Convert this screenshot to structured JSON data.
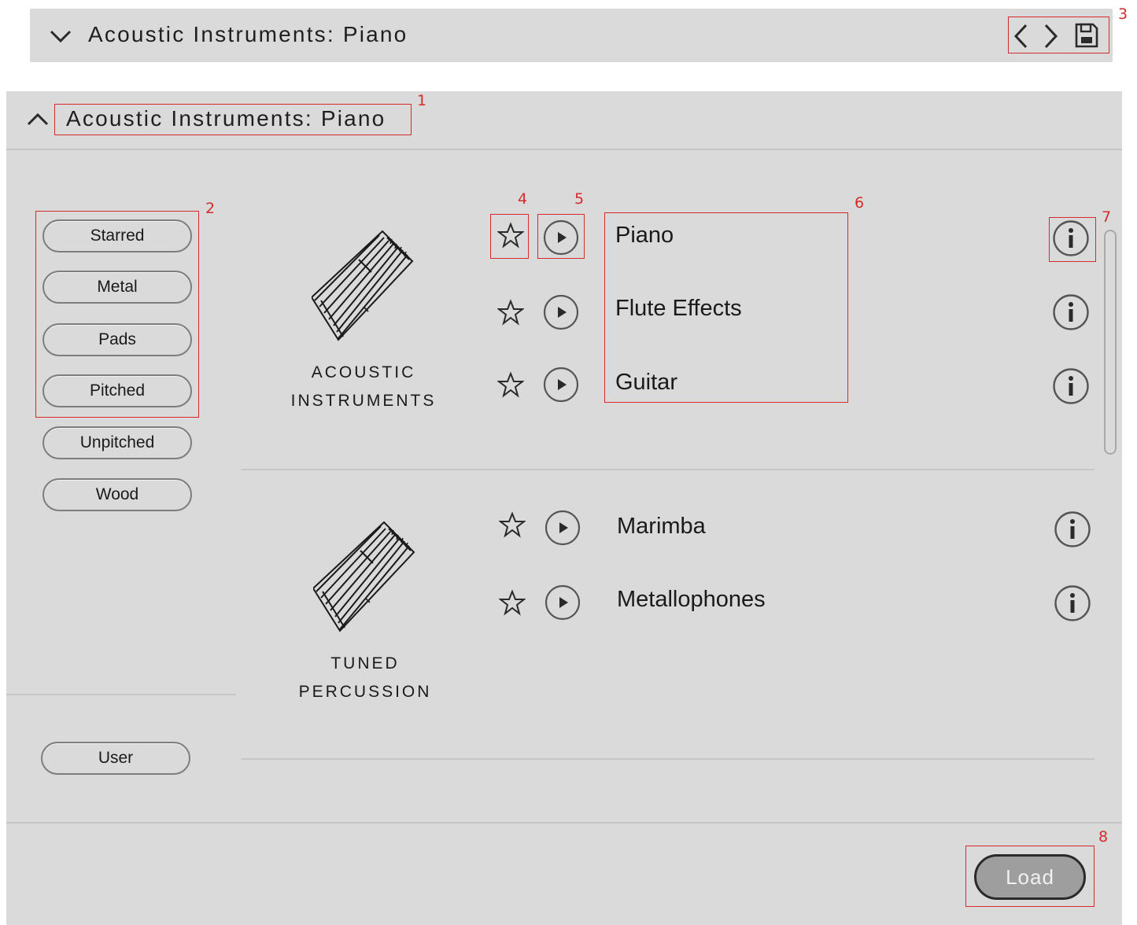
{
  "header": {
    "title": "Acoustic Instruments: Piano",
    "icons": {
      "collapse": "chevron-down-icon",
      "prev": "chevron-left-icon",
      "next": "chevron-right-icon",
      "save": "save-icon"
    }
  },
  "browser": {
    "title": "Acoustic Instruments: Piano",
    "tags": [
      "Starred",
      "Metal",
      "Pads",
      "Pitched",
      "Unpitched",
      "Wood"
    ],
    "user_label": "User",
    "categories": [
      {
        "label_line1": "ACOUSTIC",
        "label_line2": "INSTRUMENTS",
        "sounds": [
          "Piano",
          "Flute Effects",
          "Guitar"
        ]
      },
      {
        "label_line1": "TUNED",
        "label_line2": "PERCUSSION",
        "sounds": [
          "Marimba",
          "Metallophones"
        ]
      }
    ],
    "load_label": "Load"
  },
  "callouts": [
    "1",
    "2",
    "3",
    "4",
    "5",
    "6",
    "7",
    "8"
  ],
  "colors": {
    "panel": "#dadada",
    "callout": "#d42b2b",
    "load_button": "#9e9e9e"
  }
}
